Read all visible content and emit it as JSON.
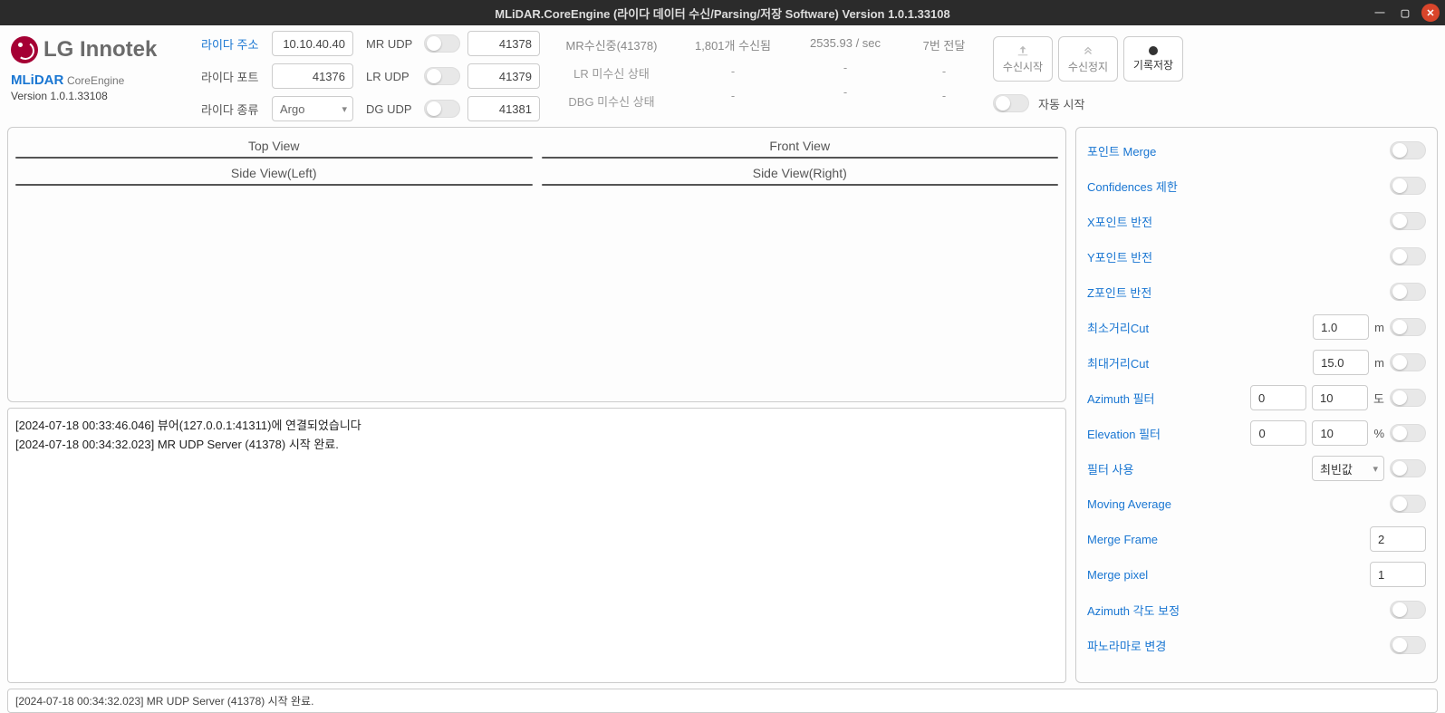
{
  "window": {
    "title": "MLiDAR.CoreEngine (라이다 데이터 수신/Parsing/저장 Software) Version 1.0.1.33108"
  },
  "brand": {
    "company": "LG Innotek",
    "product": "MLiDAR",
    "product_sub": "CoreEngine",
    "version": "Version 1.0.1.33108"
  },
  "conn": {
    "addr_label": "라이다 주소",
    "addr_value": "10.10.40.40",
    "port_label": "라이다 포트",
    "port_value": "41376",
    "type_label": "라이다 종류",
    "type_value": "Argo"
  },
  "udp": {
    "mr_label": "MR UDP",
    "mr_port": "41378",
    "lr_label": "LR UDP",
    "lr_port": "41379",
    "dg_label": "DG UDP",
    "dg_port": "41381"
  },
  "status": {
    "mr": "MR수신중(41378)",
    "lr": "LR 미수신 상태",
    "dg": "DBG 미수신 상태",
    "recv_count": "1,801개 수신됨",
    "col2_dash": "-",
    "rate": "2535.93 / sec",
    "col3_dash": "-",
    "delivery": "7번 전달",
    "col4_dash": "-"
  },
  "actions": {
    "start": "수신시작",
    "stop": "수신정지",
    "save": "기록저장",
    "auto_start": "자동 시작"
  },
  "views": {
    "top": "Top View",
    "front": "Front View",
    "left": "Side View(Left)",
    "right": "Side View(Right)"
  },
  "log": {
    "lines": [
      "[2024-07-18 00:33:46.046] 뷰어(127.0.0.1:41311)에 연결되었습니다",
      "[2024-07-18 00:34:32.023] MR UDP Server (41378)  시작 완료."
    ]
  },
  "statusbar": "[2024-07-18 00:34:32.023] MR UDP Server (41378)  시작 완료.",
  "side": {
    "point_merge": "포인트 Merge",
    "confidences": "Confidences 제한",
    "x_invert": "X포인트 반전",
    "y_invert": "Y포인트 반전",
    "z_invert": "Z포인트 반전",
    "min_cut": "최소거리Cut",
    "min_cut_val": "1.0",
    "max_cut": "최대거리Cut",
    "max_cut_val": "15.0",
    "unit_m": "m",
    "azimuth_filter": "Azimuth 필터",
    "az_min": "0",
    "az_max": "10",
    "unit_deg": "도",
    "elevation_filter": "Elevation 필터",
    "el_min": "0",
    "el_max": "10",
    "unit_pct": "%",
    "filter_use": "필터 사용",
    "filter_use_val": "최빈값",
    "moving_avg": "Moving Average",
    "merge_frame": "Merge Frame",
    "merge_frame_val": "2",
    "merge_pixel": "Merge pixel",
    "merge_pixel_val": "1",
    "azimuth_corr": "Azimuth 각도 보정",
    "panorama": "파노라마로 변경"
  }
}
